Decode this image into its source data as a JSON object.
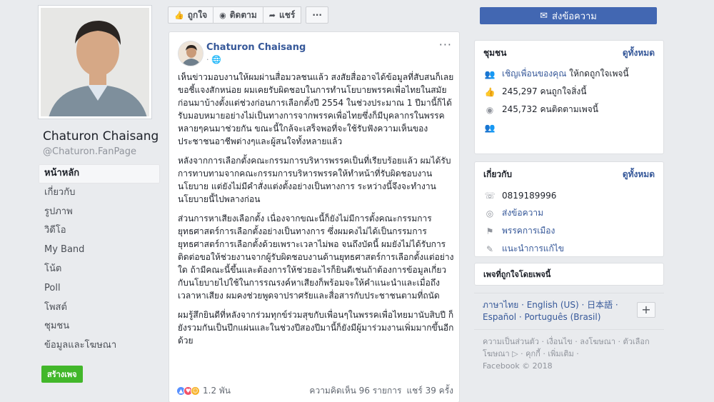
{
  "page": {
    "name": "Chaturon Chaisang",
    "handle": "@Chaturon.FanPage"
  },
  "nav": {
    "items": [
      {
        "label": "หน้าหลัก"
      },
      {
        "label": "เกี่ยวกับ"
      },
      {
        "label": "รูปภาพ"
      },
      {
        "label": "วิดีโอ"
      },
      {
        "label": "My Band"
      },
      {
        "label": "โน้ต"
      },
      {
        "label": "Poll"
      },
      {
        "label": "โพสต์"
      },
      {
        "label": "ชุมชน"
      },
      {
        "label": "ข้อมูลและโฆษณา"
      }
    ],
    "create_button": "สร้างเพจ"
  },
  "actionbar": {
    "like": "ถูกใจ",
    "follow": "ติดตาม",
    "share": "แชร์",
    "more": "···"
  },
  "post": {
    "author": "Chaturon Chaisang",
    "meta": "· 🌐",
    "menu": "···",
    "paragraphs": [
      "เห็นข่าวมอบงานให้ผมผ่านสื่อมวลชนแล้ว สงสัยสื่ออาจได้ข้อมูลที่สับสนก็เลยขอชี้แจงสักหน่อย ผมเคยรับผิดชอบในการทำนโยบายพรรคเพื่อไทยในสมัยก่อนมาบ้างตั้งแต่ช่วงก่อนการเลือกตั้งปี 2554 ในช่วงประมาณ 1 ปีมานี้ก็ได้รับมอบหมายอย่างไม่เป็นทางการจากพรรคเพื่อไทยซึ่งก็มีบุคลากรในพรรคหลายๆคนมาช่วยกัน ขณะนี้ใกล้จะเสร็จพอที่จะใช้รับฟังความเห็นของประชาชนอาชีพต่างๆและผู้สนใจทั้งหลายแล้ว",
      "หลังจากการเลือกตั้งคณะกรรมการบริหารพรรคเป็นที่เรียบร้อยแล้ว ผมได้รับการทาบทามจากคณะกรรมการบริหารพรรคให้ทำหน้าที่รับผิดชอบงานนโยบาย แต่ยังไม่มีคำสั่งแต่งตั้งอย่างเป็นทางการ ระหว่างนี้จึงจะทำงานนโยบายนี้ไปพลางก่อน",
      "ส่วนการหาเสียงเลือกตั้ง เนื่องจากขณะนี้ก็ยังไม่มีการตั้งคณะกรรมการยุทธศาสตร์การเลือกตั้งอย่างเป็นทางการ ซึ่งผมคงไม่ได้เป็นกรรมการยุทธศาสตร์การเลือกตั้งด้วยเพราะเวลาไม่พอ จนถึงบัดนี้ ผมยังไม่ได้รับการติดต่อขอให้ช่วยงานจากผู้รับผิดชอบงานด้านยุทธศาสตร์การเลือกตั้งแต่อย่างใด ถ้ามีคณะนี้ขึ้นและต้องการให้ช่วยอะไรก็ยินดีเช่นถ้าต้องการข้อมูลเกี่ยวกับนโยบายไปใช้ในการรณรงค์หาเสียงก็พร้อมจะให้คำแนะนำและเมื่อถึงเวลาหาเสียง ผมคงช่วยพูดจาปราศรัยและสื่อสารกับประชาชนตามที่ถนัด",
      "ผมรู้สึกยินดีที่หลังจากร่วมทุกข์ร่วมสุขกับเพื่อนๆในพรรคเพื่อไทยมานับสิบปี ก็ยังรวมกันเป็นปึกแผ่นและในช่วงปีสองปีมานี้ก็ยังมีผู้มาร่วมงานเพิ่มมากขึ้นอีกด้วย"
    ],
    "reaction_count": "1.2 พัน",
    "comments": "ความคิดเห็น 96 รายการ",
    "shares": "แชร์ 39 ครั้ง"
  },
  "right": {
    "message_button": "ส่งข้อความ",
    "community": {
      "title": "ชุมชน",
      "see_all": "ดูทั้งหมด",
      "invite_link": "เชิญเพื่อนของคุณ",
      "invite_rest": " ให้กดถูกใจเพจนี้",
      "likes": "245,297 คนถูกใจสิ่งนี้",
      "follows": "245,732 คนติดตามเพจนี้"
    },
    "about": {
      "title": "เกี่ยวกับ",
      "see_all": "ดูทั้งหมด",
      "phone": "0819189996",
      "send_message": "ส่งข้อความ",
      "category": "พรรคการเมือง",
      "suggest_edit": "แนะนำการแก้ไข"
    },
    "liked_pages": {
      "title": "เพจที่ถูกใจโดยเพจนี้"
    },
    "languages": {
      "text": "ภาษาไทย · English (US) · 日本語 · Español · Português (Brasil)",
      "plus": "+"
    },
    "footer": {
      "links": "ความเป็นส่วนตัว · เงื่อนไข · ลงโฆษณา · ตัวเลือกโฆษณา ▷ · คุกกี้ · เพิ่มเติม ·",
      "copyright": "Facebook © 2018"
    }
  },
  "colors": {
    "brand": "#4267b2",
    "link": "#365899",
    "create_button": "#42b72a",
    "background": "#e9ebee"
  }
}
